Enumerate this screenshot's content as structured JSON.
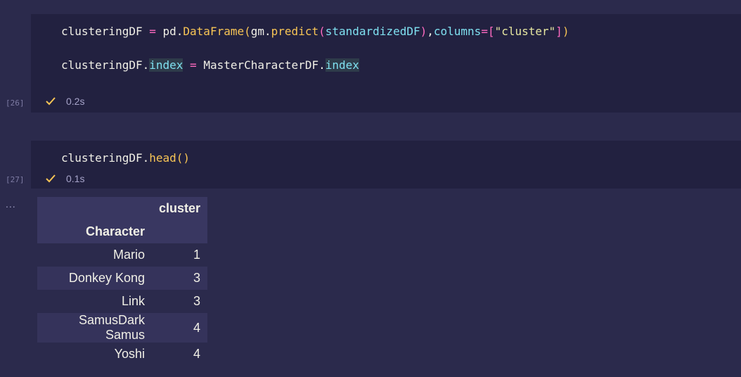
{
  "cells": [
    {
      "execution_count": "[26]",
      "lines": [
        {
          "tokens": [
            {
              "text": "clusteringDF",
              "cls": "c-var"
            },
            {
              "text": " ",
              "cls": "c-var"
            },
            {
              "text": "=",
              "cls": "c-op"
            },
            {
              "text": " pd.",
              "cls": "c-var"
            },
            {
              "text": "DataFrame",
              "cls": "c-fn"
            },
            {
              "text": "(",
              "cls": "c-paren1"
            },
            {
              "text": "gm",
              "cls": "c-var"
            },
            {
              "text": ".",
              "cls": "c-var"
            },
            {
              "text": "predict",
              "cls": "c-fn"
            },
            {
              "text": "(",
              "cls": "c-paren2"
            },
            {
              "text": "standardizedDF",
              "cls": "c-attr"
            },
            {
              "text": ")",
              "cls": "c-paren2"
            },
            {
              "text": ",",
              "cls": "c-var"
            },
            {
              "text": "columns",
              "cls": "c-attr"
            },
            {
              "text": "=",
              "cls": "c-op"
            },
            {
              "text": "[",
              "cls": "c-paren2"
            },
            {
              "text": "\"cluster\"",
              "cls": "c-str"
            },
            {
              "text": "]",
              "cls": "c-paren2"
            },
            {
              "text": ")",
              "cls": "c-paren1"
            }
          ]
        },
        {
          "tokens": [
            {
              "text": "clusteringDF",
              "cls": "c-var"
            },
            {
              "text": ".",
              "cls": "c-var"
            },
            {
              "text": "index",
              "cls": "c-attr hl"
            },
            {
              "text": " ",
              "cls": "c-var"
            },
            {
              "text": "=",
              "cls": "c-op"
            },
            {
              "text": " MasterCharacterDF",
              "cls": "c-var"
            },
            {
              "text": ".",
              "cls": "c-var"
            },
            {
              "text": "index",
              "cls": "c-attr hl"
            }
          ]
        }
      ],
      "status": {
        "icon": "check-icon",
        "duration": "0.2s"
      }
    },
    {
      "execution_count": "[27]",
      "lines": [
        {
          "tokens": [
            {
              "text": "clusteringDF",
              "cls": "c-var"
            },
            {
              "text": ".",
              "cls": "c-var"
            },
            {
              "text": "head",
              "cls": "c-fn"
            },
            {
              "text": "()",
              "cls": "c-paren1"
            }
          ]
        }
      ],
      "status": {
        "icon": "check-icon",
        "duration": "0.1s"
      }
    }
  ],
  "output": {
    "menu_icon": "ellipsis-icon",
    "ellipsis": "...",
    "table": {
      "column_header": "cluster",
      "index_name": "Character",
      "rows": [
        {
          "index": "Mario",
          "value": "1"
        },
        {
          "index": "Donkey Kong",
          "value": "3"
        },
        {
          "index": "Link",
          "value": "3"
        },
        {
          "index": "SamusDark Samus",
          "value": "4"
        },
        {
          "index": "Yoshi",
          "value": "4"
        }
      ]
    }
  },
  "colors": {
    "background": "#2b2a4c",
    "cell_background": "#222140",
    "check": "#f8c555"
  }
}
